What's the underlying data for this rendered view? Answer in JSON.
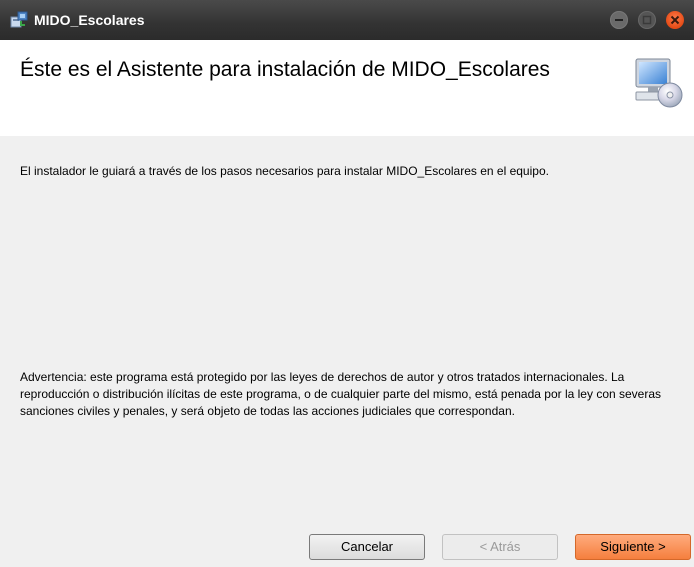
{
  "window": {
    "title": "MIDO_Escolares",
    "icons": {
      "app": "installer-icon",
      "minimize": "minimize-icon",
      "maximize": "maximize-icon",
      "close": "close-icon"
    }
  },
  "header": {
    "title": "Éste es el Asistente para instalación de MIDO_Escolares",
    "icon": "computer-disc-icon"
  },
  "content": {
    "intro": "El instalador le guiará a través de los pasos necesarios para instalar MIDO_Escolares en el equipo.",
    "warning": "Advertencia: este programa está protegido por las leyes de derechos de autor y otros tratados internacionales. La reproducción o distribución ilícitas de este programa, o de cualquier parte del mismo, está penada por la ley con severas sanciones civiles y penales, y será objeto de todas las acciones judiciales que correspondan."
  },
  "buttons": {
    "cancel": "Cancelar",
    "back": "< Atrás",
    "next": "Siguiente >"
  },
  "colors": {
    "next_button": "#f57f3e",
    "titlebar": "#333333",
    "close_button": "#e44b16"
  }
}
